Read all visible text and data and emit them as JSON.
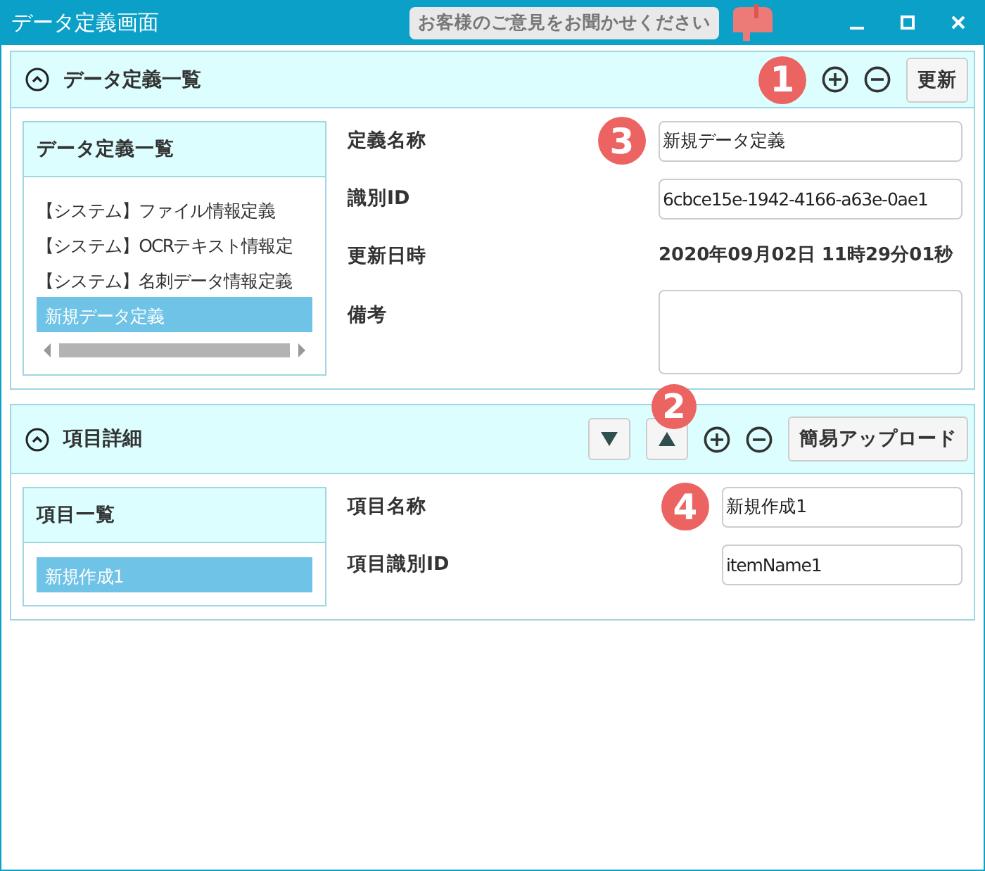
{
  "window": {
    "title": "データ定義画面",
    "feedback": "お客様のご意見をお聞かせください"
  },
  "panels": [
    {
      "title": "データ定義一覧",
      "expanded": true,
      "toolbar": [
        {
          "kind": "badge",
          "label": "1"
        },
        {
          "kind": "add"
        },
        {
          "kind": "remove"
        },
        {
          "kind": "button",
          "label": "更新"
        }
      ],
      "list": {
        "header": "データ定義一覧",
        "horizontal_scrollbar": true,
        "items": [
          {
            "label": "【システム】ファイル情報定義",
            "selected": false
          },
          {
            "label": "【システム】OCRテキスト情報定",
            "selected": false
          },
          {
            "label": "【システム】名刺データ情報定義",
            "selected": false
          },
          {
            "label": "新規データ定義",
            "selected": true
          }
        ]
      },
      "fields": [
        {
          "kind": "input",
          "label": "定義名称",
          "value": "新規データ定義",
          "badge": "3"
        },
        {
          "kind": "input",
          "label": "識別ID",
          "value": "6cbce15e-1942-4166-a63e-0ae1"
        },
        {
          "kind": "text",
          "label": "更新日時",
          "value": "2020年09月02日 11時29分01秒"
        },
        {
          "kind": "textarea",
          "label": "備考"
        }
      ]
    },
    {
      "title": "項目詳細",
      "expanded": true,
      "toolbar": [
        {
          "kind": "down"
        },
        {
          "kind": "up",
          "badge": "2"
        },
        {
          "kind": "add"
        },
        {
          "kind": "remove"
        },
        {
          "kind": "button",
          "label": "簡易アップロード"
        }
      ],
      "list": {
        "header": "項目一覧",
        "horizontal_scrollbar": false,
        "items": [
          {
            "label": "新規作成1",
            "selected": true
          }
        ]
      },
      "fields": [
        {
          "kind": "input",
          "label": "項目名称",
          "value": "新規作成1",
          "badge": "4"
        },
        {
          "kind": "input",
          "label": "項目識別ID",
          "value": "itemName1"
        }
      ]
    }
  ]
}
